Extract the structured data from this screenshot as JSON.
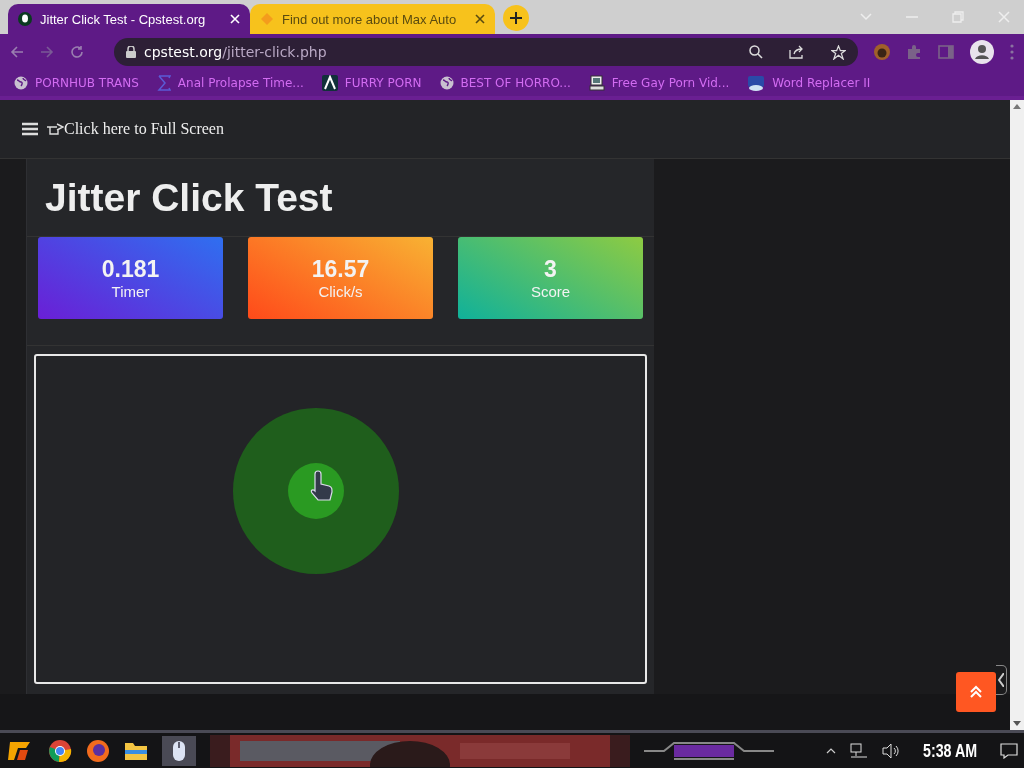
{
  "browser": {
    "tabs": [
      {
        "title": "Jitter Click Test - Cpstest.org",
        "selected": true
      },
      {
        "title": "Find out more about Max Auto",
        "selected": false
      }
    ],
    "url": {
      "domain": "cpstest.org",
      "path": "/jitter-click.php"
    },
    "bookmarks": [
      {
        "label": "PORNHUB TRANS",
        "kind": "globe"
      },
      {
        "label": "Anal Prolapse Time...",
        "kind": "sigma"
      },
      {
        "label": "FURRY PORN",
        "kind": "lambda"
      },
      {
        "label": "BEST OF HORRO...",
        "kind": "globe"
      },
      {
        "label": "Free Gay Porn Vid...",
        "kind": "computer"
      },
      {
        "label": "Word Replacer II",
        "kind": "badge"
      }
    ]
  },
  "page": {
    "nav": {
      "fullscreen_link": "Click here to Full Screen"
    },
    "title": "Jitter Click Test",
    "stats": [
      {
        "value": "0.181",
        "label": "Timer",
        "kind": "timer"
      },
      {
        "value": "16.57",
        "label": "Click/s",
        "kind": "speed"
      },
      {
        "value": "3",
        "label": "Score",
        "kind": "score"
      }
    ]
  },
  "taskbar": {
    "clock": "5:38 AM"
  }
}
